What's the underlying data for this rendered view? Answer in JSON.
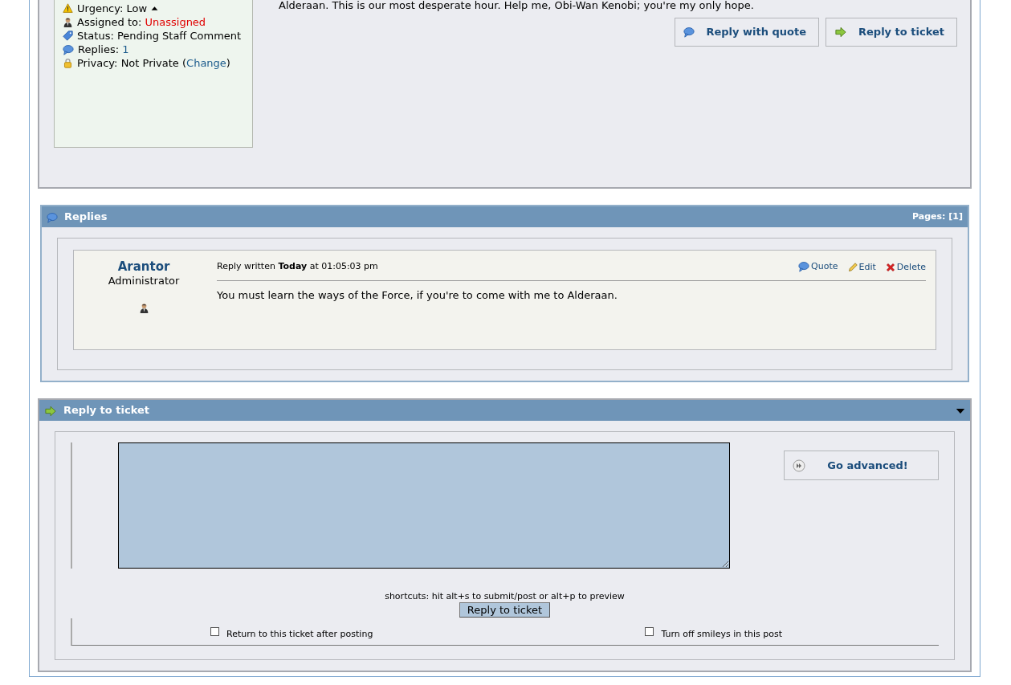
{
  "ticket": {
    "info": [
      {
        "kind": "urgency",
        "label": "Urgency: Low"
      },
      {
        "kind": "assigned",
        "label": "Assigned to: ",
        "value": "Unassigned"
      },
      {
        "kind": "status",
        "label": "Status: Pending Staff Comment"
      },
      {
        "kind": "replies",
        "label": "Replies: ",
        "link": "1"
      },
      {
        "kind": "privacy",
        "label": "Privacy: Not Private (",
        "link": "Change",
        "suffix": ")"
      }
    ],
    "body": "Alderaan. This is our most desperate hour. Help me, Obi-Wan Kenobi; you're my only hope.",
    "buttons": [
      {
        "kind": "quote",
        "label": "Reply with quote"
      },
      {
        "kind": "reply",
        "label": "Reply to ticket"
      }
    ]
  },
  "replies": {
    "title": "Replies",
    "pages": "Pages: [1]",
    "posts": [
      {
        "author": "Arantor",
        "role": "Administrator",
        "meta": "Reply written **Today** at 01:05:03 pm",
        "body": "You must learn the ways of the Force, if you're to come with me to Alderaan.",
        "actions": [
          {
            "kind": "quote",
            "label": "Quote"
          },
          {
            "kind": "edit",
            "label": "Edit"
          },
          {
            "kind": "delete",
            "label": "Delete"
          }
        ]
      }
    ]
  },
  "reply_form": {
    "title": "Reply to ticket",
    "expanded": true,
    "advanced_button": "Go advanced!",
    "shortcuts": "shortcuts: hit alt+s to submit/post or alt+p to preview",
    "submit": "Reply to ticket",
    "options": [
      {
        "label": "Return to this ticket after posting",
        "checked": false
      },
      {
        "label": "Turn off smileys in this post",
        "checked": false
      }
    ]
  }
}
